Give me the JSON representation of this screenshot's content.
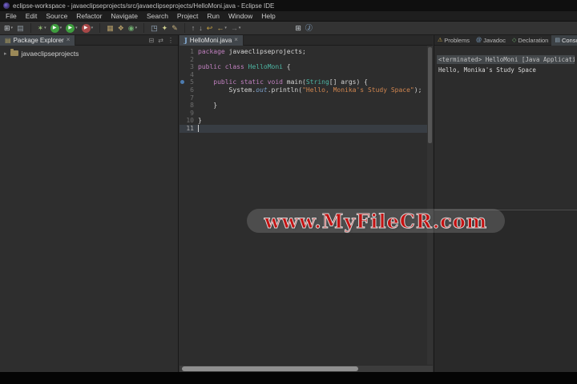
{
  "window": {
    "title": "eclipse-workspace - javaeclipseprojects/src/javaeclipseprojects/HelloMoni.java - Eclipse IDE"
  },
  "menubar": {
    "items": [
      "File",
      "Edit",
      "Source",
      "Refactor",
      "Navigate",
      "Search",
      "Project",
      "Run",
      "Window",
      "Help"
    ]
  },
  "toolbar": {
    "icons": [
      {
        "name": "new-wizard-icon",
        "glyph": "⊞",
        "color": "#cdd3d8",
        "caret": true
      },
      {
        "name": "save-icon",
        "glyph": "▤",
        "color": "#8f9aa3"
      },
      {
        "spacer": 3
      },
      {
        "name": "debug-icon",
        "glyph": "✶",
        "color": "#8fba6f",
        "caret": true
      },
      {
        "name": "run-icon",
        "glyph": "▶",
        "color": "#ffffff",
        "bg": "#3f9e3f",
        "caret": true
      },
      {
        "name": "coverage-icon",
        "glyph": "▶",
        "color": "#ffffff",
        "bg": "#3f9e3f",
        "caret": true
      },
      {
        "name": "external-tools-icon",
        "glyph": "▶",
        "color": "#ffffff",
        "bg": "#a84848",
        "caret": true
      },
      {
        "spacer": 3
      },
      {
        "name": "new-java-project-icon",
        "glyph": "▦",
        "color": "#b39b66"
      },
      {
        "name": "new-package-icon",
        "glyph": "❖",
        "color": "#b39b66"
      },
      {
        "name": "new-class-icon",
        "glyph": "◉",
        "color": "#6fae6f",
        "caret": true
      },
      {
        "spacer": 3
      },
      {
        "name": "open-type-icon",
        "glyph": "◳",
        "color": "#9fb4c9"
      },
      {
        "name": "search-icon",
        "glyph": "✦",
        "color": "#cfcf8f"
      },
      {
        "name": "mark-occurrences-icon",
        "glyph": "✎",
        "color": "#c9b27f"
      },
      {
        "spacer": 3
      },
      {
        "name": "prev-annotation-icon",
        "glyph": "↑",
        "color": "#a8a8a8"
      },
      {
        "name": "next-annotation-icon",
        "glyph": "↓",
        "color": "#a8a8a8"
      },
      {
        "name": "last-edit-location-icon",
        "glyph": "↩",
        "color": "#c9a23f"
      },
      {
        "name": "back-icon",
        "glyph": "←",
        "color": "#d7b45a",
        "caret": true
      },
      {
        "name": "forward-icon",
        "glyph": "→",
        "color": "#7d7d7d",
        "caret": true
      },
      {
        "gap": 58
      },
      {
        "name": "open-perspective-icon",
        "glyph": "⊞",
        "color": "#cdd3d8"
      },
      {
        "name": "java-perspective-icon",
        "glyph": "Ⓙ",
        "color": "#8fb3d9"
      }
    ]
  },
  "package_explorer": {
    "tab_icon": "▤",
    "tab_label": "Package Explorer",
    "tab_close": "×",
    "tools": {
      "collapse_all": "⊟",
      "link_editor": "⇄",
      "view_menu": "⋮"
    },
    "items": [
      {
        "chevron": "▸",
        "label": "javaeclipseprojects"
      }
    ]
  },
  "editor": {
    "tab": {
      "icon": "J",
      "label": "HelloMoni.java",
      "close": "×"
    },
    "lines": [
      {
        "num": 1,
        "tokens": [
          {
            "type": "kw",
            "text": "package"
          },
          {
            "type": "plain",
            "text": " javaeclipseprojects;"
          }
        ]
      },
      {
        "num": 2,
        "tokens": []
      },
      {
        "num": 3,
        "tokens": [
          {
            "type": "kw",
            "text": "public class "
          },
          {
            "type": "type",
            "text": "HelloMoni"
          },
          {
            "type": "plain",
            "text": " {"
          }
        ]
      },
      {
        "num": 4,
        "tokens": []
      },
      {
        "num": 5,
        "marker": true,
        "tokens": [
          {
            "type": "plain",
            "text": "    "
          },
          {
            "type": "kw",
            "text": "public static void "
          },
          {
            "type": "func",
            "text": "main"
          },
          {
            "type": "plain",
            "text": "("
          },
          {
            "type": "type",
            "text": "String"
          },
          {
            "type": "plain",
            "text": "[] args) {"
          }
        ]
      },
      {
        "num": 6,
        "tokens": [
          {
            "type": "plain",
            "text": "        System."
          },
          {
            "type": "field",
            "text": "out"
          },
          {
            "type": "plain",
            "text": ".println("
          },
          {
            "type": "string",
            "text": "\"Hello, Monika's Study Space\""
          },
          {
            "type": "plain",
            "text": ");"
          }
        ]
      },
      {
        "num": 7,
        "tokens": []
      },
      {
        "num": 8,
        "tokens": [
          {
            "type": "plain",
            "text": "    }"
          }
        ]
      },
      {
        "num": 9,
        "tokens": []
      },
      {
        "num": 10,
        "tokens": [
          {
            "type": "plain",
            "text": "}"
          }
        ]
      },
      {
        "num": 11,
        "current": true,
        "tokens": []
      }
    ]
  },
  "right_panel": {
    "tabs": [
      {
        "label": "Problems",
        "icon": "⚠",
        "icon_name": "problems-icon",
        "icon_color": "#caa94f"
      },
      {
        "label": "Javadoc",
        "icon": "@",
        "icon_name": "javadoc-icon",
        "icon_color": "#7fa3c7"
      },
      {
        "label": "Declaration",
        "icon": "◇",
        "icon_name": "declaration-icon",
        "icon_color": "#6fae6f"
      },
      {
        "label": "Console",
        "icon": "▤",
        "icon_name": "console-icon",
        "icon_color": "#9ab0c2",
        "active": true
      }
    ],
    "tools": {
      "minimize": "–",
      "maximize": "▢"
    },
    "console": {
      "header": "<terminated> HelloMoni [Java Application] C:\\Users\\Mon",
      "output": "Hello, Monika's Study Space"
    }
  },
  "watermark": {
    "text": "www.MyFileCR.com"
  },
  "colors": {
    "accent_run_green": "#3f9e3f",
    "keyword": "#c080bf",
    "type": "#4db6a4",
    "string": "#d0854f",
    "watermark_red": "#c41212"
  }
}
